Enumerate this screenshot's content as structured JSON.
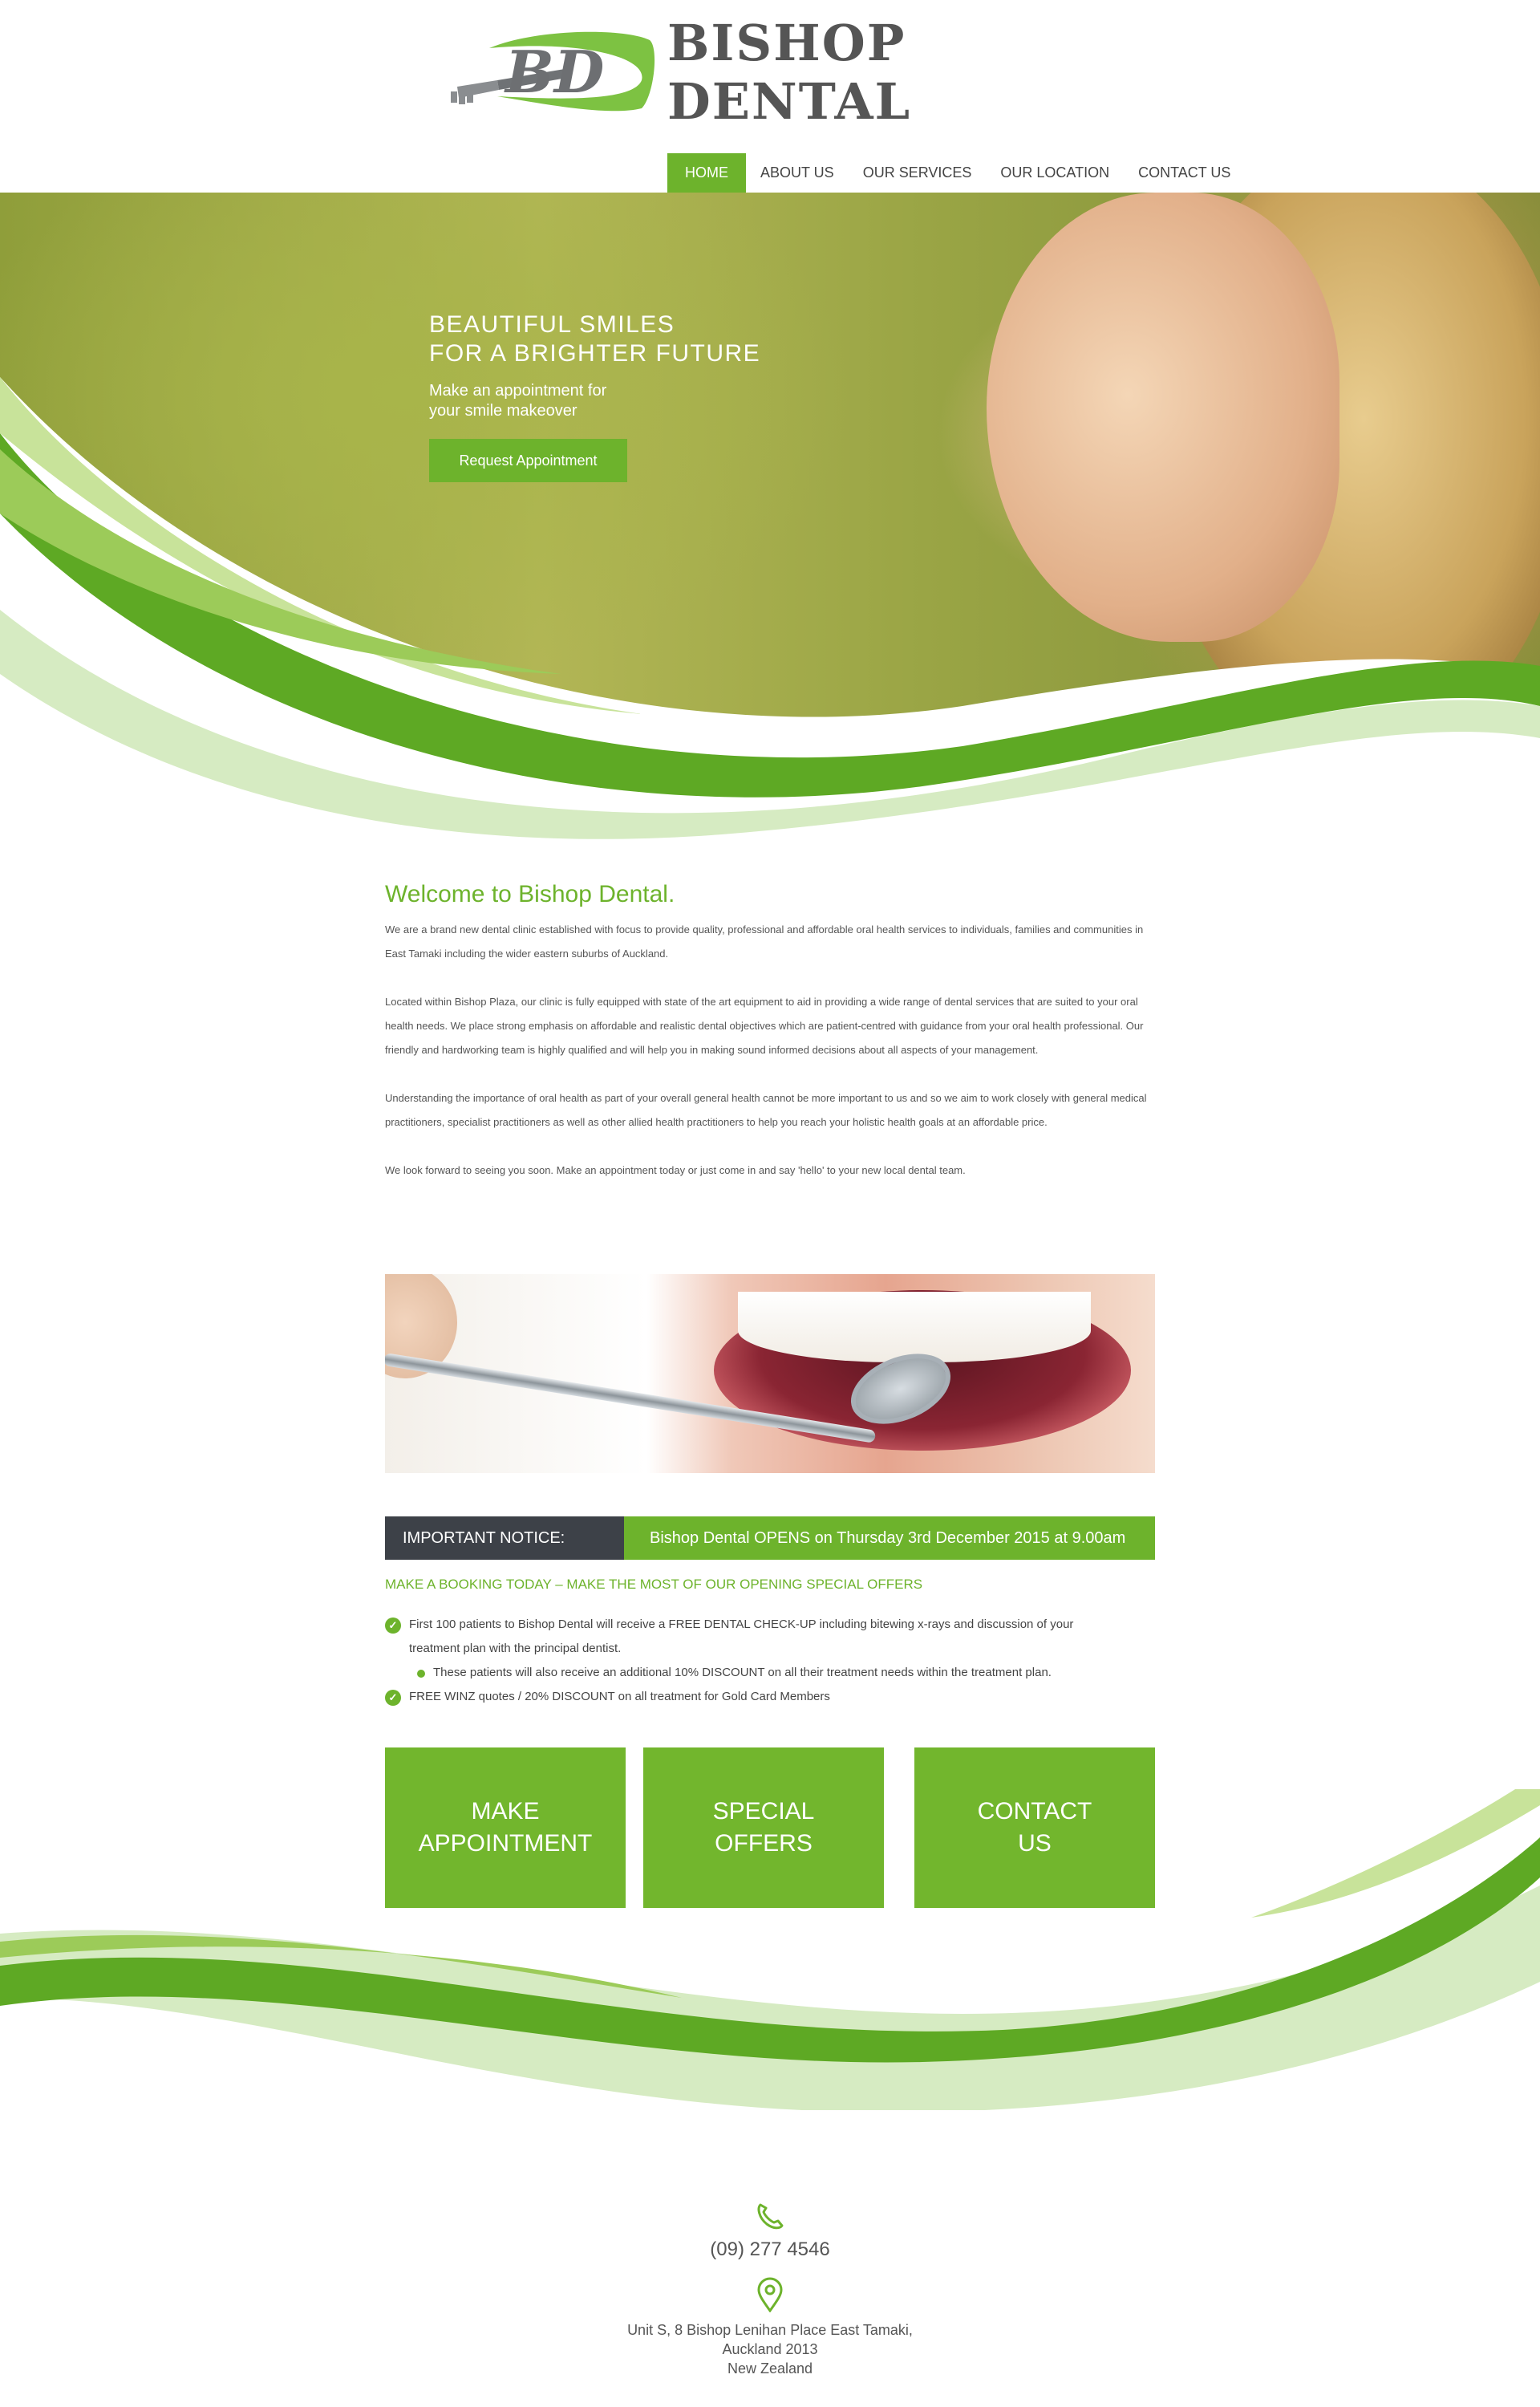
{
  "brand": {
    "initials": "BD",
    "name": "BISHOP DENTAL"
  },
  "colors": {
    "green": "#6db32c",
    "dark": "#3d4148",
    "text": "#555555"
  },
  "nav": {
    "items": [
      {
        "label": "HOME",
        "active": true
      },
      {
        "label": "ABOUT US"
      },
      {
        "label": "OUR SERVICES"
      },
      {
        "label": "OUR LOCATION"
      },
      {
        "label": "CONTACT US"
      }
    ]
  },
  "hero": {
    "title_line1": "BEAUTIFUL SMILES",
    "title_line2": "FOR A BRIGHTER FUTURE",
    "subtitle_line1": "Make an appointment for",
    "subtitle_line2": "your smile makeover",
    "button_label": "Request Appointment"
  },
  "welcome": {
    "title": "Welcome to Bishop Dental.",
    "paragraphs": [
      "We are a brand new dental clinic established with focus to provide quality, professional and affordable oral health services to individuals, families and communities in East Tamaki including the wider eastern suburbs of Auckland.",
      "Located within Bishop Plaza, our clinic is fully equipped with state of the art equipment to aid in providing a wide range of dental services that are suited to your oral health needs. We place strong emphasis on affordable and realistic dental objectives which are patient-centred with guidance from your oral health professional. Our friendly and hardworking team is highly qualified and will help you in making sound informed decisions about all aspects of your management.",
      "Understanding the importance of oral health as part of your overall general health cannot be more important to us and so we aim to work closely with general medical practitioners, specialist practitioners as well as other allied health practitioners to help you reach your holistic health goals at an affordable price.",
      "We look forward to seeing you soon. Make an appointment today or just come in and say 'hello' to your new local dental team."
    ]
  },
  "notice": {
    "label": "IMPORTANT NOTICE:",
    "text": "Bishop Dental OPENS on Thursday 3rd December 2015 at 9.00am"
  },
  "booking_heading": "MAKE A BOOKING TODAY – MAKE THE MOST OF OUR OPENING SPECIAL OFFERS",
  "offers": {
    "first_line1": "First 100 patients to Bishop Dental will receive a FREE DENTAL CHECK-UP including bitewing x-rays and discussion of your",
    "first_line2": "treatment plan with the principal dentist.",
    "sub": "These patients will also receive an additional 10% DISCOUNT on all their treatment needs within the treatment plan.",
    "second": "FREE WINZ quotes / 20% DISCOUNT on all treatment for Gold Card Members"
  },
  "cta": [
    {
      "line1": "MAKE",
      "line2": "APPOINTMENT"
    },
    {
      "line1": "SPECIAL",
      "line2": "OFFERS"
    },
    {
      "line1": "CONTACT",
      "line2": "US"
    }
  ],
  "footer": {
    "phone_icon": "phone-icon",
    "phone": "(09) 277 4546",
    "location_icon": "location-pin-icon",
    "address_line1": "Unit S, 8 Bishop Lenihan Place East Tamaki,",
    "address_line2": "Auckland 2013",
    "address_line3": "New Zealand"
  }
}
